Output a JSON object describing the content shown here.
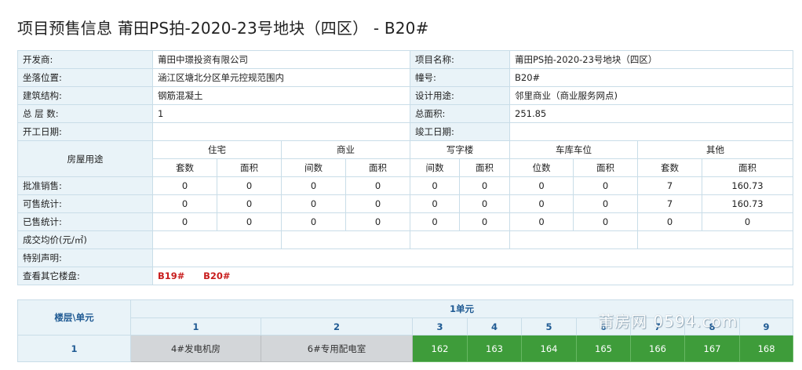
{
  "page": {
    "title": "项目预售信息 莆田PS拍-2020-23号地块（四区）  - B20#"
  },
  "info": {
    "developer_label": "开发商:",
    "developer": "莆田中璟投资有限公司",
    "project_name_label": "项目名称:",
    "project_name": "莆田PS拍-2020-23号地块（四区）",
    "location_label": "坐落位置:",
    "location": "涵江区塘北分区单元控规范围内",
    "building_no_label": "幢号:",
    "building_no": "B20#",
    "structure_label": "建筑结构:",
    "structure": "钢筋混凝土",
    "usage_label": "设计用途:",
    "usage": "邻里商业（商业服务网点)",
    "floors_label": "总 层 数:",
    "floors": "1",
    "area_label": "总面积:",
    "area": "251.85",
    "start_label": "开工日期:",
    "start": "",
    "finish_label": "竣工日期:",
    "finish": ""
  },
  "stats": {
    "row_header": "房屋用途",
    "groups": [
      "住宅",
      "商业",
      "写字楼",
      "车库车位",
      "其他"
    ],
    "subheaders": [
      "套数",
      "面积",
      "间数",
      "面积",
      "间数",
      "面积",
      "位数",
      "面积",
      "套数",
      "面积"
    ],
    "rows": [
      {
        "label": "批准销售:",
        "values": [
          "0",
          "0",
          "0",
          "0",
          "0",
          "0",
          "0",
          "0",
          "7",
          "160.73"
        ]
      },
      {
        "label": "可售统计:",
        "values": [
          "0",
          "0",
          "0",
          "0",
          "0",
          "0",
          "0",
          "0",
          "7",
          "160.73"
        ]
      },
      {
        "label": "已售统计:",
        "values": [
          "0",
          "0",
          "0",
          "0",
          "0",
          "0",
          "0",
          "0",
          "0",
          "0"
        ]
      }
    ],
    "avg_price_label": "成交均价(元/㎡)",
    "special_label": "特别声明:",
    "other_label": "查看其它楼盘:",
    "other_links": [
      "B19#",
      "B20#"
    ]
  },
  "units": {
    "corner_label": "楼层\\单元",
    "unit_group": "1单元",
    "columns": [
      "1",
      "2",
      "3",
      "4",
      "5",
      "6",
      "7",
      "8",
      "9"
    ],
    "floor": "1",
    "rooms": [
      "4#发电机房",
      "6#专用配电室",
      "162",
      "163",
      "164",
      "165",
      "166",
      "167",
      "168"
    ]
  },
  "watermark": "莆房网 0594.com"
}
